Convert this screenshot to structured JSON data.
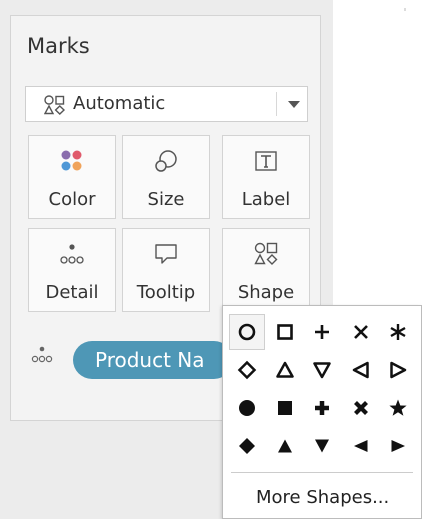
{
  "marks": {
    "title": "Marks",
    "mark_type": {
      "icon": "automatic-shapes-icon",
      "value": "Automatic"
    },
    "cards": [
      {
        "label": "Color",
        "icon": "color-icon"
      },
      {
        "label": "Size",
        "icon": "size-icon"
      },
      {
        "label": "Label",
        "icon": "label-icon"
      },
      {
        "label": "Detail",
        "icon": "detail-icon"
      },
      {
        "label": "Tooltip",
        "icon": "tooltip-icon"
      },
      {
        "label": "Shape",
        "icon": "shape-icon"
      }
    ],
    "field_pill": {
      "icon": "detail-icon",
      "label": "Product Na",
      "color": "#4e97b6"
    }
  },
  "shape_picker": {
    "shapes": [
      "circle-outline",
      "square-outline",
      "plus",
      "x",
      "asterisk",
      "diamond-outline",
      "triangle-up-outline",
      "triangle-down-outline",
      "triangle-left-outline",
      "triangle-right-outline",
      "circle-filled",
      "square-filled",
      "plus-filled",
      "x-filled",
      "star",
      "diamond-filled",
      "triangle-up-filled",
      "triangle-down-filled",
      "triangle-left-filled",
      "triangle-right-filled"
    ],
    "selected": "circle-outline",
    "more_label": "More Shapes..."
  },
  "colors": {
    "pill": "#4e97b6",
    "swatch_purple": "#8a6dad",
    "swatch_red": "#e05a6b",
    "swatch_blue": "#4e97d6",
    "swatch_orange": "#f0a35a"
  }
}
